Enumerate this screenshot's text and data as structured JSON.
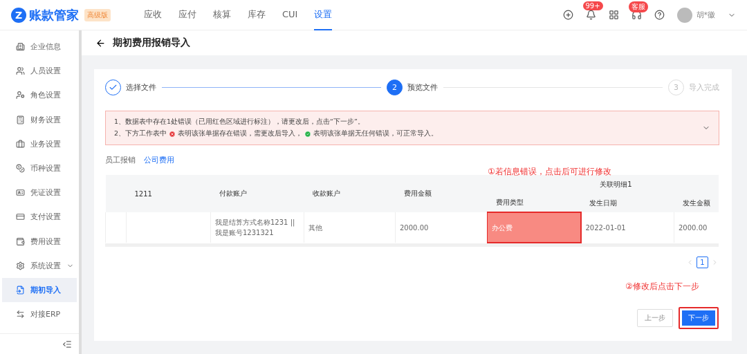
{
  "app": {
    "logo_letter": "Z",
    "name": "账款管家",
    "edition": "高级版"
  },
  "nav": [
    {
      "label": "应收",
      "selected": false
    },
    {
      "label": "应付",
      "selected": false
    },
    {
      "label": "核算",
      "selected": false
    },
    {
      "label": "库存",
      "selected": false
    },
    {
      "label": "CUI",
      "selected": false
    },
    {
      "label": "设置",
      "selected": true
    }
  ],
  "badges": {
    "notifications": "99+",
    "service": "客服"
  },
  "user": {
    "name": "胡*徽"
  },
  "sidebar": [
    {
      "label": "企业信息",
      "kind": "link",
      "selected": false
    },
    {
      "label": "人员设置",
      "kind": "link",
      "selected": false
    },
    {
      "label": "角色设置",
      "kind": "link",
      "selected": false
    },
    {
      "label": "财务设置",
      "kind": "link",
      "selected": false
    },
    {
      "label": "业务设置",
      "kind": "link",
      "selected": false
    },
    {
      "label": "币种设置",
      "kind": "link",
      "selected": false
    },
    {
      "label": "凭证设置",
      "kind": "link",
      "selected": false
    },
    {
      "label": "支付设置",
      "kind": "link",
      "selected": false
    },
    {
      "label": "费用设置",
      "kind": "link",
      "selected": false
    },
    {
      "label": "系统设置",
      "kind": "group",
      "selected": false
    },
    {
      "label": "期初导入",
      "kind": "link",
      "selected": true
    },
    {
      "label": "对接ERP",
      "kind": "link",
      "selected": false
    }
  ],
  "page": {
    "title": "期初费用报销导入"
  },
  "steps": [
    {
      "label": "选择文件",
      "done": true,
      "current": false
    },
    {
      "number": "2",
      "label": "预览文件",
      "done": false,
      "current": true
    },
    {
      "number": "3",
      "label": "导入完成",
      "done": false,
      "current": false
    }
  ],
  "alert": {
    "lines": [
      [
        {
          "kind": "text",
          "text": "1、数据表中存在1处错误（已用红色区域进行标注），请更改后，点击“下一步”。"
        }
      ],
      [
        {
          "kind": "text",
          "text": "2、下方工作表中"
        },
        {
          "kind": "error"
        },
        {
          "kind": "text",
          "text": "表明该张单据存在错误，需更改后导入，"
        },
        {
          "kind": "ok"
        },
        {
          "kind": "text",
          "text": "表明该张单据无任何错误，可正常导入。"
        }
      ]
    ]
  },
  "sheet_tabs": [
    {
      "label": "员工报销",
      "selected": false
    },
    {
      "label": "公司费用",
      "selected": true
    }
  ],
  "table": {
    "columns": [
      "",
      "1211",
      "付款账户",
      "收款账户",
      "费用金额"
    ],
    "group": {
      "label": "关联明细1",
      "columns": [
        "费用类型",
        "发生日期",
        "发生金额"
      ]
    },
    "rows": [
      {
        "cells": [
          {
            "text": "",
            "error": false
          },
          {
            "text": "",
            "error": false
          },
          {
            "text": "我是结算方式名称1231 || 我是账号1231321",
            "error": false
          },
          {
            "text": "其他",
            "error": false
          },
          {
            "text": "2000.00",
            "error": false
          },
          {
            "text": "办公费",
            "error": true
          },
          {
            "text": "2022-01-01",
            "error": false
          },
          {
            "text": "2000.00",
            "error": false
          }
        ]
      }
    ]
  },
  "pagination": [
    {
      "label": "1",
      "selected": true
    }
  ],
  "annotations": [
    "①若信息错误，点击后可进行修改",
    "②修改后点击下一步"
  ],
  "buttons": [
    {
      "label": "上一步",
      "kind": "secondary",
      "highlighted": false
    },
    {
      "label": "下一步",
      "kind": "primary",
      "highlighted": true
    }
  ]
}
